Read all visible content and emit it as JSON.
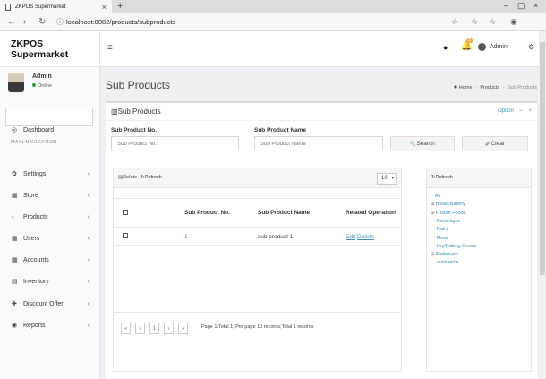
{
  "browser": {
    "tab_title": "ZKPOS Supermarket",
    "tab_close": "×",
    "new_tab": "+",
    "window_buttons": [
      "–",
      "▢",
      "×"
    ],
    "url": "localhost:8082/products/subproducts",
    "nav_icons": [
      "←",
      "›",
      "↻",
      "ⓘ"
    ],
    "toolbar_icons": [
      "☆",
      "☆",
      "☆",
      "◉",
      "···"
    ]
  },
  "app": {
    "brand": "ZKPOS Supermarket",
    "hamburger": "≡",
    "github_icon": "●",
    "bell_icon": "🔔",
    "bell_count": "1",
    "user_name": "Admin",
    "gears_icon": "⚙"
  },
  "sidebar": {
    "user_name": "Admin",
    "user_status": "Online",
    "nav_header": "MAIN NAVIGATION",
    "items": [
      {
        "label": "Dashboard",
        "icon": "◎",
        "chevron": ""
      },
      {
        "label": "Settings",
        "icon": "✿",
        "chevron": "‹"
      },
      {
        "label": "Store",
        "icon": "▦",
        "chevron": "‹"
      },
      {
        "label": "Products",
        "icon": "◐",
        "chevron": "‹"
      },
      {
        "label": "Users",
        "icon": "▦",
        "chevron": "‹"
      },
      {
        "label": "Accounts",
        "icon": "▦",
        "chevron": "‹"
      },
      {
        "label": "Inventory",
        "icon": "▤",
        "chevron": "‹"
      },
      {
        "label": "Discount Offer",
        "icon": "✚",
        "chevron": "‹"
      },
      {
        "label": "Reports",
        "icon": "◉",
        "chevron": "‹"
      }
    ]
  },
  "content": {
    "page_title": "Sub Products",
    "breadcrumb": {
      "home": "Home",
      "products": "Products",
      "current": "Sub Products",
      "home_icon": "✱",
      "sep": "›"
    },
    "box_title": "Sub Products",
    "box_title_icon": "▥",
    "box_tools": {
      "option": "Option",
      "collapse": "–",
      "close": "×"
    },
    "filters": {
      "no_label": "Sub Product No.",
      "no_placeholder": "Sub Product No.",
      "name_label": "Sub Product Name",
      "name_placeholder": "Sub Product Name",
      "search_label": "Search",
      "search_icon": "🔍",
      "clear_label": "Clear",
      "clear_icon": "✐"
    },
    "grid": {
      "delete_label": "Delete",
      "delete_icon": "▤",
      "refresh_label": "Refresh",
      "refresh_icon": "↻",
      "page_size": "10",
      "page_size_caret": "▾",
      "columns": [
        "",
        "Sub Product No.",
        "Sub Product Name",
        "Related Operation"
      ],
      "rows": [
        {
          "no": "1",
          "name": "sub product 1",
          "edit": "Edit",
          "delete": "Delete"
        }
      ],
      "pager": {
        "first": "«",
        "prev": "‹",
        "page": "1",
        "next": "›",
        "last": "»",
        "info": "Page 1/Total 1; Per page 10 records;Total 1 records"
      }
    },
    "tree": {
      "refresh_label": "Refresh",
      "refresh_icon": "↻",
      "nodes": [
        {
          "label": "All",
          "glyph": "·"
        },
        {
          "label": "Bread/Bakery",
          "glyph": "⊞"
        },
        {
          "label": "Frozen Foods",
          "glyph": "⊞"
        },
        {
          "label": "Beverages",
          "glyph": "·"
        },
        {
          "label": "Dairy",
          "glyph": "·"
        },
        {
          "label": "Meat",
          "glyph": "·"
        },
        {
          "label": "Dry/Baking Goods",
          "glyph": "·"
        },
        {
          "label": "Stationary",
          "glyph": "⊞"
        },
        {
          "label": "cosmetics",
          "glyph": "·"
        }
      ]
    }
  }
}
